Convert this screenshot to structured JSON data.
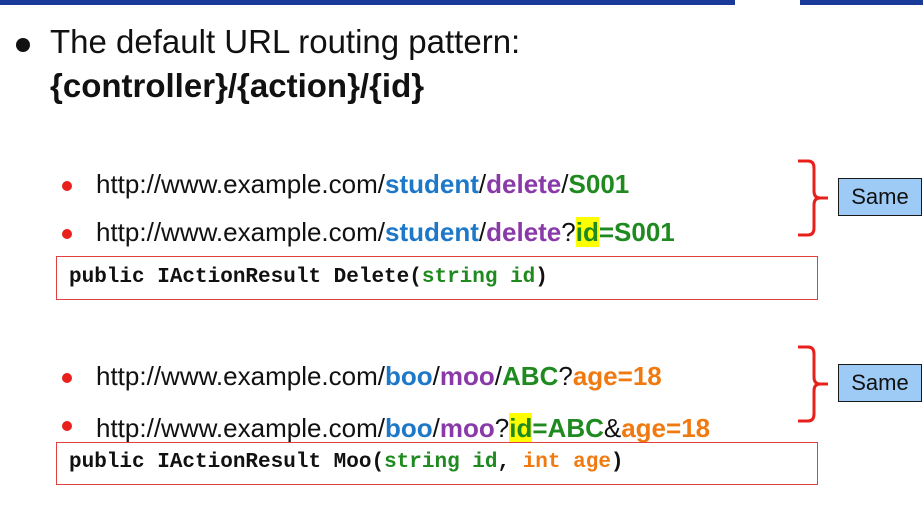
{
  "heading": {
    "title": "The default URL routing pattern:",
    "pattern": "{controller}/{action}/{id}"
  },
  "group1": {
    "url1": {
      "base": "http://www.example.com/",
      "controller": "student",
      "sep1": "/",
      "action": "delete",
      "sep2": "/",
      "id": "S001"
    },
    "url2": {
      "base": "http://www.example.com/",
      "controller": "student",
      "sep1": "/",
      "action": "delete",
      "q": "?",
      "key": "id",
      "eq": "=S001"
    },
    "code": {
      "sig": "public IActionResult Delete(",
      "param": "string id",
      "close": ")"
    },
    "same_label": "Same"
  },
  "group2": {
    "url1": {
      "base": "http://www.example.com/",
      "controller": "boo",
      "sep1": "/",
      "action": "moo",
      "sep2": "/",
      "id": "ABC",
      "q": "?",
      "query": "age=18"
    },
    "url2": {
      "base": "http://www.example.com/",
      "controller": "boo",
      "sep1": "/",
      "action": "moo",
      "q": "?",
      "key": "id",
      "eq": "=ABC",
      "amp": "&",
      "query": "age=18"
    },
    "code": {
      "sig": "public IActionResult Moo(",
      "param1": "string id",
      "comma": ", ",
      "param2": "int age",
      "close": ")"
    },
    "same_label": "Same"
  },
  "colors": {
    "controller": "#1e78c8",
    "action": "#8a3aa8",
    "id": "#1f8a1f",
    "query": "#f07a10",
    "highlight": "#ffff00",
    "same_box": "#9dcbf5",
    "accent": "#e8201c"
  }
}
